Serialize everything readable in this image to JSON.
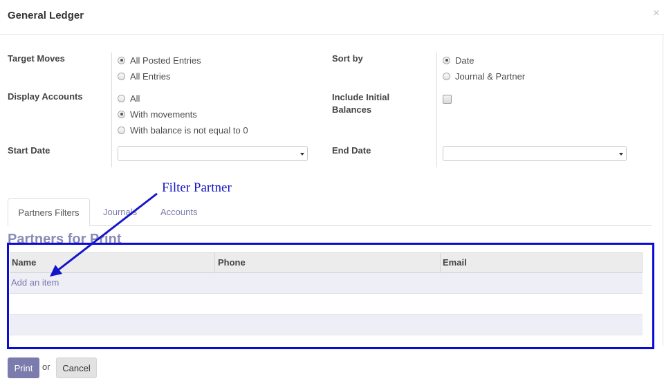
{
  "dialog": {
    "title": "General Ledger",
    "close": "×"
  },
  "form": {
    "target_moves": {
      "label": "Target Moves",
      "options": [
        "All Posted Entries",
        "All Entries"
      ],
      "selected": "All Posted Entries"
    },
    "display_accounts": {
      "label": "Display Accounts",
      "options": [
        "All",
        "With movements",
        "With balance is not equal to 0"
      ],
      "selected": "With movements"
    },
    "start_date": {
      "label": "Start Date",
      "value": ""
    },
    "sort_by": {
      "label": "Sort by",
      "options": [
        "Date",
        "Journal & Partner"
      ],
      "selected": "Date"
    },
    "include_initial_balances": {
      "label_line1": "Include Initial",
      "label_line2": "Balances",
      "checked": false
    },
    "end_date": {
      "label": "End Date",
      "value": ""
    }
  },
  "tabs": [
    {
      "label": "Partners Filters",
      "active": true
    },
    {
      "label": "Journals",
      "active": false
    },
    {
      "label": "Accounts",
      "active": false
    }
  ],
  "partners": {
    "section_title": "Partners for Print",
    "columns": [
      "Name",
      "Phone",
      "Email"
    ],
    "add_item": "Add an item"
  },
  "annotation": {
    "text": "Filter Partner",
    "color": "#1515c8"
  },
  "footer": {
    "print_label": "Print",
    "or_text": "or",
    "cancel_label": "Cancel"
  },
  "colors": {
    "accent": "#7c7bad",
    "highlight_box": "#0b0bd8"
  }
}
